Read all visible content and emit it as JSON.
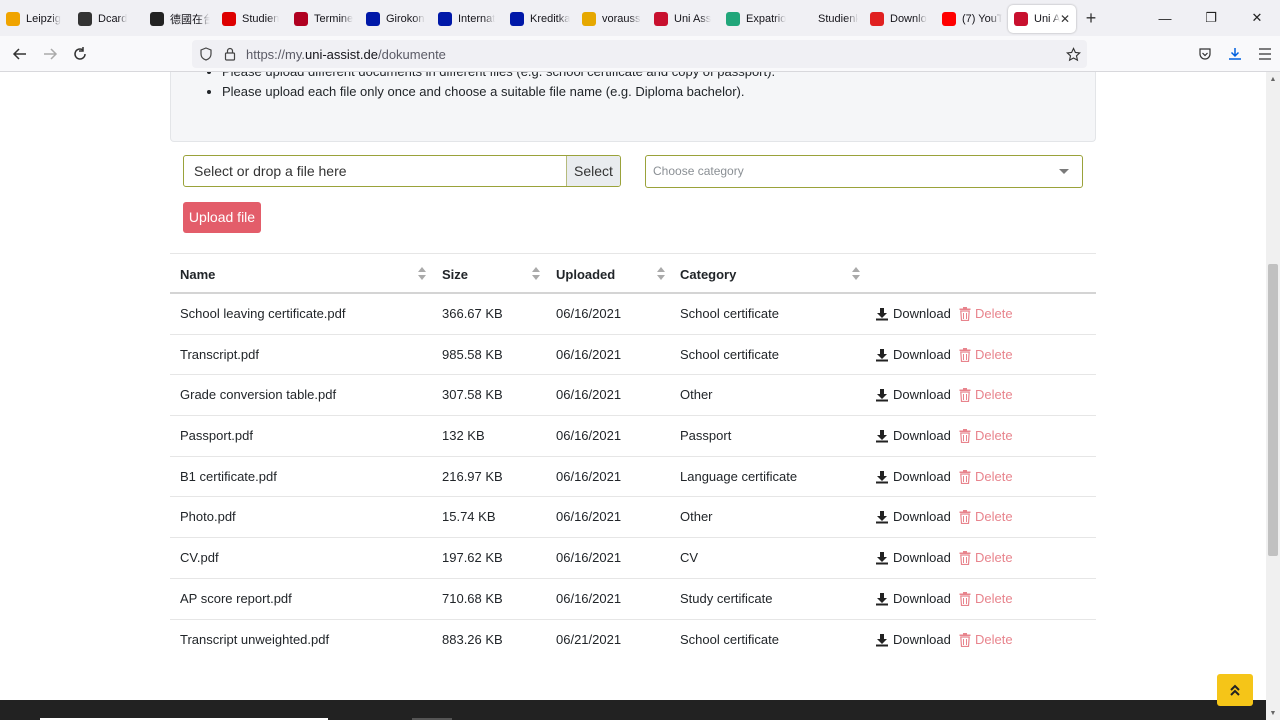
{
  "browser": {
    "tabs": [
      {
        "label": "Leipzig",
        "icon": "y-icon",
        "color": "#f0a400"
      },
      {
        "label": "Dcard",
        "icon": "dcard-icon",
        "color": "#333333"
      },
      {
        "label": "德國在台",
        "icon": "flag-icon",
        "color": "#222222"
      },
      {
        "label": "Studien",
        "icon": "de-flag-icon",
        "color": "#dd0000"
      },
      {
        "label": "Termine",
        "icon": "sik-icon",
        "color": "#b00020"
      },
      {
        "label": "Girokon",
        "icon": "db-icon",
        "color": "#0018a8"
      },
      {
        "label": "Internat",
        "icon": "db-icon",
        "color": "#0018a8"
      },
      {
        "label": "Kreditka",
        "icon": "db-icon",
        "color": "#0018a8"
      },
      {
        "label": "vorauss",
        "icon": "color-icon",
        "color": "#e6a800"
      },
      {
        "label": "Uni Ass",
        "icon": "uniassist-icon",
        "color": "#c8102e"
      },
      {
        "label": "Expatrio",
        "icon": "x-icon",
        "color": "#21a67a"
      },
      {
        "label": "Studienkolle",
        "icon": "none",
        "color": "#f0f0f4"
      },
      {
        "label": "Downlo",
        "icon": "heart-icon",
        "color": "#e02020"
      },
      {
        "label": "(7) YouT",
        "icon": "youtube-icon",
        "color": "#ff0000"
      },
      {
        "label": "Uni A",
        "icon": "uniassist-icon",
        "color": "#c8102e",
        "active": true
      }
    ],
    "url_prefix": "https://my.",
    "url_host": "uni-assist.de",
    "url_path": "/dokumente"
  },
  "notice": {
    "items": [
      "Please upload different documents in different files (e.g. school certificate and copy of passport).",
      "Please upload each file only once and choose a suitable file name (e.g. Diploma bachelor)."
    ]
  },
  "upload": {
    "file_placeholder": "Select or drop a file here",
    "select_label": "Select",
    "category_placeholder": "Choose category",
    "upload_button": "Upload file"
  },
  "table": {
    "headers": [
      "Name",
      "Size",
      "Uploaded",
      "Category"
    ],
    "download_label": "Download",
    "delete_label": "Delete",
    "rows": [
      {
        "name": "School leaving certificate.pdf",
        "size": "366.67 KB",
        "uploaded": "06/16/2021",
        "category": "School certificate"
      },
      {
        "name": "Transcript.pdf",
        "size": "985.58 KB",
        "uploaded": "06/16/2021",
        "category": "School certificate"
      },
      {
        "name": "Grade conversion table.pdf",
        "size": "307.58 KB",
        "uploaded": "06/16/2021",
        "category": "Other"
      },
      {
        "name": "Passport.pdf",
        "size": "132 KB",
        "uploaded": "06/16/2021",
        "category": "Passport"
      },
      {
        "name": "B1 certificate.pdf",
        "size": "216.97 KB",
        "uploaded": "06/16/2021",
        "category": "Language certificate"
      },
      {
        "name": "Photo.pdf",
        "size": "15.74 KB",
        "uploaded": "06/16/2021",
        "category": "Other"
      },
      {
        "name": "CV.pdf",
        "size": "197.62 KB",
        "uploaded": "06/16/2021",
        "category": "CV"
      },
      {
        "name": "AP score report.pdf",
        "size": "710.68 KB",
        "uploaded": "06/16/2021",
        "category": "Study certificate"
      },
      {
        "name": "Transcript unweighted.pdf",
        "size": "883.26 KB",
        "uploaded": "06/21/2021",
        "category": "School certificate"
      }
    ]
  },
  "colors": {
    "accent_border": "#9aa23a",
    "upload_button": "#e35d6a",
    "delete_text": "#e8848d",
    "scroll_top_button": "#f5c518"
  }
}
